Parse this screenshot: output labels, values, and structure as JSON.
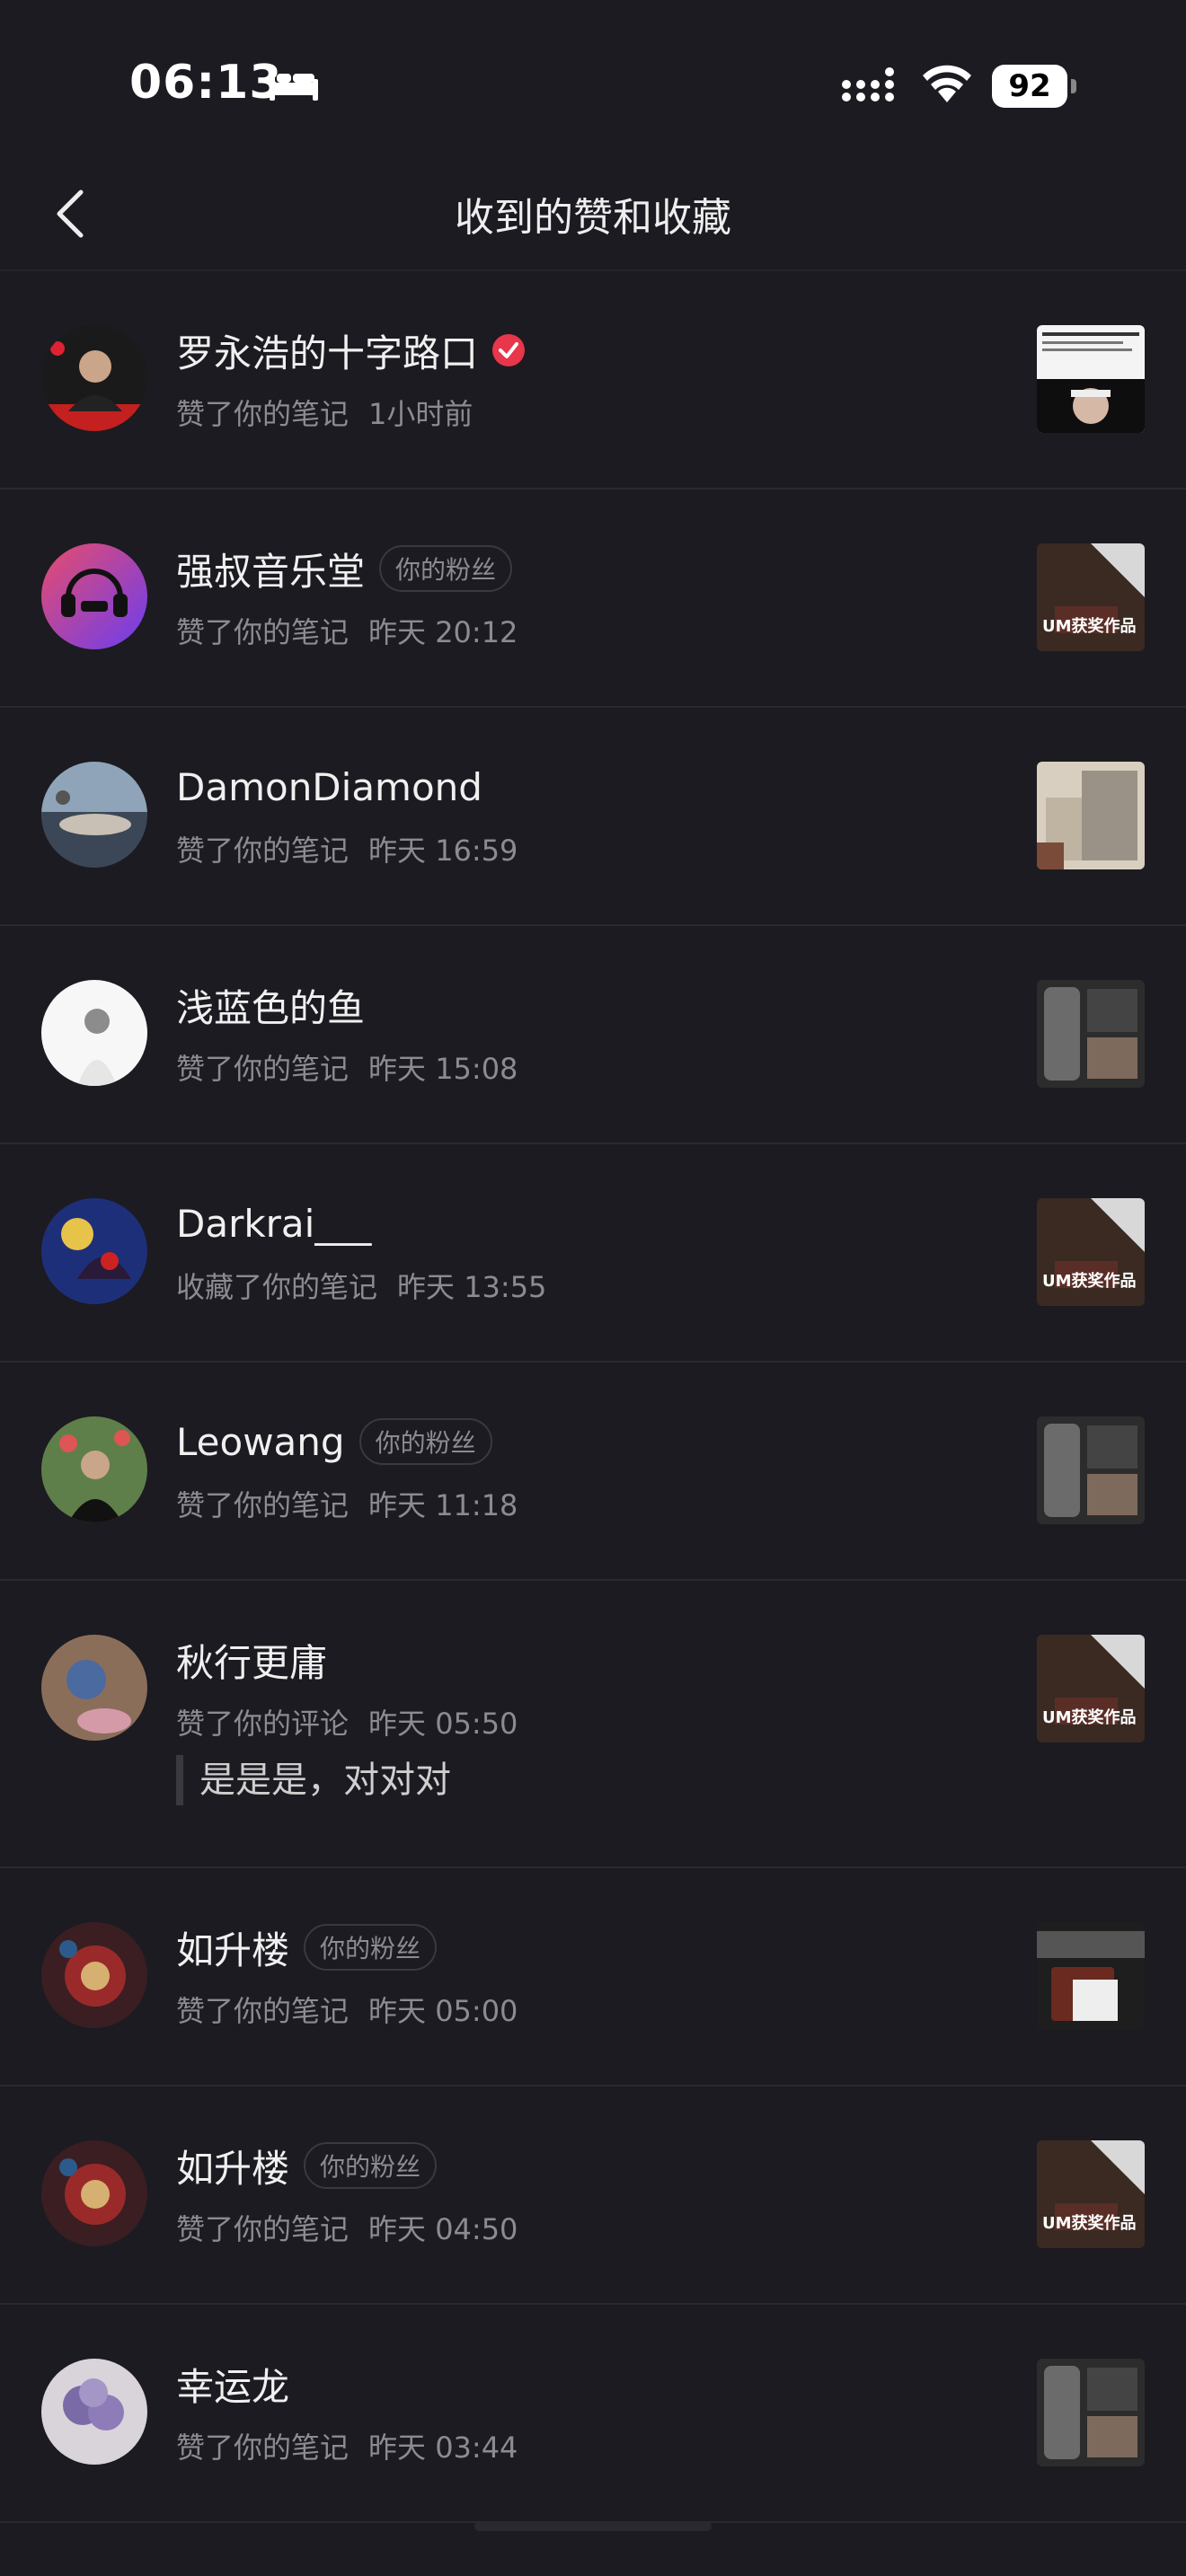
{
  "status_bar": {
    "time": "06:13",
    "battery": "92"
  },
  "header": {
    "title": "收到的赞和收藏"
  },
  "items": [
    {
      "name": "罗永浩的十字路口",
      "badge": "",
      "verified": true,
      "action": "赞了你的笔记",
      "time": "1小时前",
      "quote": ""
    },
    {
      "name": "强叔音乐堂",
      "badge": "你的粉丝",
      "verified": false,
      "action": "赞了你的笔记",
      "time": "昨天 20:12",
      "quote": ""
    },
    {
      "name": "DamonDiamond",
      "badge": "",
      "verified": false,
      "action": "赞了你的笔记",
      "time": "昨天 16:59",
      "quote": ""
    },
    {
      "name": "浅蓝色的鱼",
      "badge": "",
      "verified": false,
      "action": "赞了你的笔记",
      "time": "昨天 15:08",
      "quote": ""
    },
    {
      "name": "Darkrai___",
      "badge": "",
      "verified": false,
      "action": "收藏了你的笔记",
      "time": "昨天 13:55",
      "quote": ""
    },
    {
      "name": "Leowang",
      "badge": "你的粉丝",
      "verified": false,
      "action": "赞了你的笔记",
      "time": "昨天 11:18",
      "quote": ""
    },
    {
      "name": "秋行更庸",
      "badge": "",
      "verified": false,
      "action": "赞了你的评论",
      "time": "昨天 05:50",
      "quote": "是是是，对对对"
    },
    {
      "name": "如升楼",
      "badge": "你的粉丝",
      "verified": false,
      "action": "赞了你的笔记",
      "time": "昨天 05:00",
      "quote": ""
    },
    {
      "name": "如升楼",
      "badge": "你的粉丝",
      "verified": false,
      "action": "赞了你的笔记",
      "time": "昨天 04:50",
      "quote": ""
    },
    {
      "name": "幸运龙",
      "badge": "",
      "verified": false,
      "action": "赞了你的笔记",
      "time": "昨天 03:44",
      "quote": ""
    }
  ],
  "thumb_labels": {
    "um": "UM获奖作品"
  },
  "colors": {
    "background": "#1c1b21",
    "secondary_text": "#8c8b92",
    "verified": "#e8364a"
  }
}
